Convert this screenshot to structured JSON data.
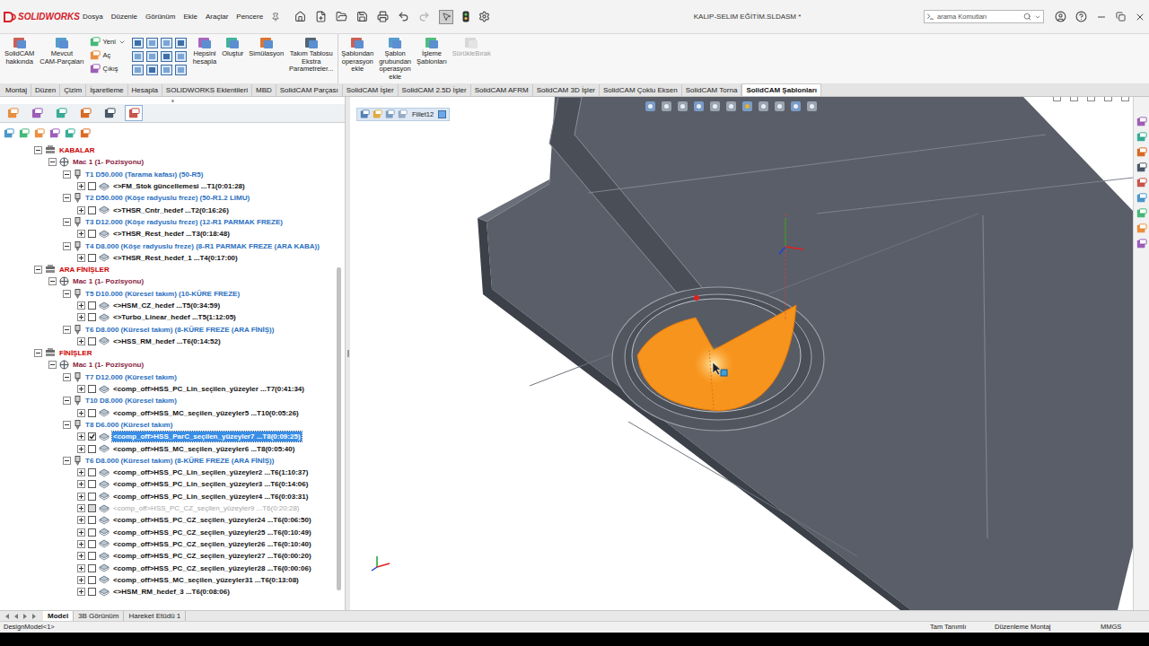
{
  "window": {
    "brand": "SOLIDWORKS",
    "title": "KALIP-SELIM EĞİTİM.SLDASM *"
  },
  "menus": [
    "Dosya",
    "Düzenle",
    "Görünüm",
    "Ekle",
    "Araçlar",
    "Pencere"
  ],
  "search": {
    "placeholder": "arama Komutları"
  },
  "ribbon": {
    "groups": [
      [
        {
          "kind": "large",
          "lines": [
            "SolidCAM",
            "hakkında"
          ],
          "disabled": false
        },
        {
          "kind": "large",
          "lines": [
            "Mevcut",
            "CAM-Parçaları"
          ],
          "disabled": false
        },
        {
          "kind": "stack",
          "items": [
            "Yeni",
            "Aç",
            "Çıkış"
          ]
        },
        {
          "kind": "grid"
        },
        {
          "kind": "large",
          "lines": [
            "Hepsini",
            "hesapla"
          ],
          "disabled": false
        },
        {
          "kind": "large",
          "lines": [
            "Oluştur"
          ],
          "disabled": false
        },
        {
          "kind": "large",
          "lines": [
            "Simülasyon"
          ],
          "disabled": false
        },
        {
          "kind": "large",
          "lines": [
            "Takım Tablosu",
            "Ekstra",
            "Parametreler..."
          ],
          "disabled": false
        }
      ],
      [
        {
          "kind": "large",
          "lines": [
            "Şablondan",
            "operasyon",
            "ekle"
          ],
          "disabled": false
        },
        {
          "kind": "large",
          "lines": [
            "Şablon",
            "grubundan",
            "operasyon",
            "ekle"
          ],
          "disabled": false
        },
        {
          "kind": "large",
          "lines": [
            "İşleme",
            "Şablonları"
          ],
          "disabled": false
        },
        {
          "kind": "large",
          "lines": [
            "SürükleBırak"
          ],
          "disabled": true
        }
      ]
    ]
  },
  "tabs": [
    {
      "label": "Montaj",
      "selected": false
    },
    {
      "label": "Düzen",
      "selected": false
    },
    {
      "label": "Çizim",
      "selected": false
    },
    {
      "label": "İşaretleme",
      "selected": false
    },
    {
      "label": "Hesapla",
      "selected": false
    },
    {
      "label": "SOLIDWORKS Eklentileri",
      "selected": false
    },
    {
      "label": "MBD",
      "selected": false
    },
    {
      "label": "SolidCAM Parçası",
      "selected": false
    },
    {
      "label": "SolidCAM İşler",
      "selected": false
    },
    {
      "label": "SolidCAM 2.5D İşler",
      "selected": false
    },
    {
      "label": "SolidCAM AFRM",
      "selected": false
    },
    {
      "label": "SolidCAM 3D İşler",
      "selected": false
    },
    {
      "label": "SolidCAM Çoklu Eksen",
      "selected": false
    },
    {
      "label": "SolidCAM Torna",
      "selected": false
    },
    {
      "label": "SolidCAM Şablonları",
      "selected": true
    }
  ],
  "feature_tabs": [
    {
      "selected": false
    },
    {
      "selected": false
    },
    {
      "selected": false
    },
    {
      "selected": false
    },
    {
      "selected": false
    },
    {
      "selected": true
    }
  ],
  "tree": [
    {
      "kind": "group",
      "label": "KABALAR",
      "expanded": true,
      "selected": false,
      "disabled": false
    },
    {
      "kind": "machine",
      "label": "Mac 1 (1- Pozisyonu)",
      "expanded": true,
      "selected": false,
      "disabled": false
    },
    {
      "kind": "tool",
      "label": "T1 D50.000  (Tarama kafası) (50-R5)",
      "expanded": true,
      "selected": false,
      "disabled": false
    },
    {
      "kind": "operation",
      "label": "<>FM_Stok güncellemesi ...T1(0:01:28)",
      "expanded": false,
      "checked": false,
      "selected": false,
      "disabled": false
    },
    {
      "kind": "tool",
      "label": "T2 D50.000  (Köşe radyuslu freze) (50-R1.2 LIMU)",
      "expanded": true,
      "selected": false,
      "disabled": false
    },
    {
      "kind": "operation",
      "label": "<>THSR_Cntr_hedef ...T2(0:16:26)",
      "expanded": false,
      "checked": false,
      "selected": false,
      "disabled": false
    },
    {
      "kind": "tool",
      "label": "T3 D12.000  (Köşe radyuslu freze) (12-R1 PARMAK FREZE)",
      "expanded": true,
      "selected": false,
      "disabled": false
    },
    {
      "kind": "operation",
      "label": "<>THSR_Rest_hedef ...T3(0:18:48)",
      "expanded": false,
      "checked": false,
      "selected": false,
      "disabled": false
    },
    {
      "kind": "tool",
      "label": "T4 D8.000  (Köşe radyuslu freze) (8-R1 PARMAK FREZE (ARA KABA))",
      "expanded": true,
      "selected": false,
      "disabled": false
    },
    {
      "kind": "operation",
      "label": "<>THSR_Rest_hedef_1 ...T4(0:17:00)",
      "expanded": false,
      "checked": false,
      "selected": false,
      "disabled": false
    },
    {
      "kind": "group",
      "label": "ARA FİNİŞLER",
      "expanded": true,
      "selected": false,
      "disabled": false
    },
    {
      "kind": "machine",
      "label": "Mac 1 (1- Pozisyonu)",
      "expanded": true,
      "selected": false,
      "disabled": false
    },
    {
      "kind": "tool",
      "label": "T5 D10.000  (Küresel takım) (10-KÜRE FREZE)",
      "expanded": true,
      "selected": false,
      "disabled": false
    },
    {
      "kind": "operation",
      "label": "<>HSM_CZ_hedef ...T5(0:34:59)",
      "expanded": false,
      "checked": false,
      "selected": false,
      "disabled": false
    },
    {
      "kind": "operation",
      "label": "<>Turbo_Linear_hedef ...T5(1:12:05)",
      "expanded": false,
      "checked": false,
      "selected": false,
      "disabled": false
    },
    {
      "kind": "tool",
      "label": "T6 D8.000  (Küresel takım) (8-KÜRE FREZE (ARA FİNİŞ))",
      "expanded": true,
      "selected": false,
      "disabled": false
    },
    {
      "kind": "operation",
      "label": "<>HSS_RM_hedef ...T6(0:14:52)",
      "expanded": false,
      "checked": false,
      "selected": false,
      "disabled": false
    },
    {
      "kind": "group",
      "label": "FİNİŞLER",
      "expanded": true,
      "selected": false,
      "disabled": false
    },
    {
      "kind": "machine",
      "label": "Mac 1 (1- Pozisyonu)",
      "expanded": true,
      "selected": false,
      "disabled": false
    },
    {
      "kind": "tool",
      "label": "T7 D12.000  (Küresel takım)",
      "expanded": true,
      "selected": false,
      "disabled": false
    },
    {
      "kind": "operation",
      "label": "<comp_off>HSS_PC_Lin_seçilen_yüzeyler ...T7(0:41:34)",
      "expanded": false,
      "checked": false,
      "selected": false,
      "disabled": false
    },
    {
      "kind": "tool",
      "label": "T10 D8.000  (Küresel takım)",
      "expanded": true,
      "selected": false,
      "disabled": false
    },
    {
      "kind": "operation",
      "label": "<comp_off>HSS_MC_seçilen_yüzeyler5 ...T10(0:05:26)",
      "expanded": false,
      "checked": false,
      "selected": false,
      "disabled": false
    },
    {
      "kind": "tool",
      "label": "T8 D6.000  (Küresel takım)",
      "expanded": true,
      "selected": false,
      "disabled": false
    },
    {
      "kind": "operation",
      "label": "<comp_off>HSS_ParC_seçilen_yüzeyler7 ...T8(0:09:25)",
      "expanded": false,
      "checked": true,
      "selected": true,
      "disabled": false
    },
    {
      "kind": "operation",
      "label": "<comp_off>HSS_MC_seçilen_yüzeyler6 ...T8(0:05:40)",
      "expanded": false,
      "checked": false,
      "selected": false,
      "disabled": false
    },
    {
      "kind": "tool",
      "label": "T6 D8.000  (Küresel takım) (8-KÜRE FREZE (ARA FİNİŞ))",
      "expanded": true,
      "selected": false,
      "disabled": false
    },
    {
      "kind": "operation",
      "label": "<comp_off>HSS_PC_Lin_seçilen_yüzeyler2 ...T6(1:10:37)",
      "expanded": false,
      "checked": false,
      "selected": false,
      "disabled": false
    },
    {
      "kind": "operation",
      "label": "<comp_off>HSS_PC_Lin_seçilen_yüzeyler3 ...T6(0:14:06)",
      "expanded": false,
      "checked": false,
      "selected": false,
      "disabled": false
    },
    {
      "kind": "operation",
      "label": "<comp_off>HSS_PC_Lin_seçilen_yüzeyler4 ...T6(0:03:31)",
      "expanded": false,
      "checked": false,
      "selected": false,
      "disabled": false
    },
    {
      "kind": "operation",
      "label": "<comp_off>HSS_PC_CZ_seçilen_yüzeyler9 ...T6(0:20:28)",
      "expanded": false,
      "checked": false,
      "selected": false,
      "disabled": true
    },
    {
      "kind": "operation",
      "label": "<comp_off>HSS_PC_CZ_seçilen_yüzeyler24 ...T6(0:06:50)",
      "expanded": false,
      "checked": false,
      "selected": false,
      "disabled": false
    },
    {
      "kind": "operation",
      "label": "<comp_off>HSS_PC_CZ_seçilen_yüzeyler25 ...T6(0:10:49)",
      "expanded": false,
      "checked": false,
      "selected": false,
      "disabled": false
    },
    {
      "kind": "operation",
      "label": "<comp_off>HSS_PC_CZ_seçilen_yüzeyler26 ...T6(0:10:40)",
      "expanded": false,
      "checked": false,
      "selected": false,
      "disabled": false
    },
    {
      "kind": "operation",
      "label": "<comp_off>HSS_PC_CZ_seçilen_yüzeyler27 ...T6(0:00:20)",
      "expanded": false,
      "checked": false,
      "selected": false,
      "disabled": false
    },
    {
      "kind": "operation",
      "label": "<comp_off>HSS_PC_CZ_seçilen_yüzeyler28 ...T6(0:00:06)",
      "expanded": false,
      "checked": false,
      "selected": false,
      "disabled": false
    },
    {
      "kind": "operation",
      "label": "<comp_off>HSS_MC_seçilen_yüzeyler31 ...T6(0:13:08)",
      "expanded": false,
      "checked": false,
      "selected": false,
      "disabled": false
    },
    {
      "kind": "operation",
      "label": "<>HSM_RM_hedef_3 ...T6(0:08:06)",
      "expanded": false,
      "checked": false,
      "selected": false,
      "disabled": false
    }
  ],
  "viewport": {
    "breadcrumb": "Fillet12"
  },
  "bottom_tabs": [
    {
      "label": "Model",
      "selected": true
    },
    {
      "label": "3B Görünüm",
      "selected": false
    },
    {
      "label": "Hareket Etüdü 1",
      "selected": false
    }
  ],
  "status_bar": {
    "left": "DesignModel<1>",
    "state": "Tam Tanımlı",
    "mode": "Düzenleme Montaj",
    "units": "MMGS"
  }
}
